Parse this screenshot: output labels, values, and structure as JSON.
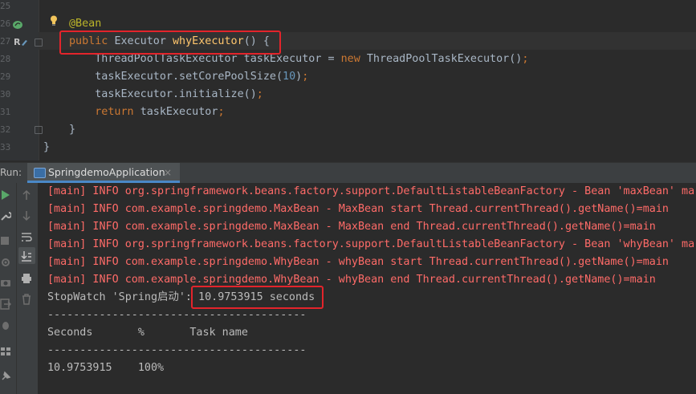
{
  "editor": {
    "line_numbers": [
      "25",
      "26",
      "27",
      "28",
      "29",
      "30",
      "31",
      "32",
      "33"
    ],
    "lines": [
      [],
      [
        {
          "t": "@Bean",
          "c": "ann"
        }
      ],
      [
        {
          "t": "public ",
          "c": "kw"
        },
        {
          "t": "Executor ",
          "c": "plain"
        },
        {
          "t": "whyExecutor",
          "c": "fn"
        },
        {
          "t": "() {",
          "c": "plain"
        }
      ],
      [
        {
          "t": "    ThreadPoolTaskExecutor taskExecutor = ",
          "c": "plain"
        },
        {
          "t": "new ",
          "c": "kw"
        },
        {
          "t": "ThreadPoolTaskExecutor()",
          "c": "plain"
        },
        {
          "t": ";",
          "c": "kw"
        }
      ],
      [
        {
          "t": "    taskExecutor.setCorePoolSize(",
          "c": "plain"
        },
        {
          "t": "10",
          "c": "num"
        },
        {
          "t": ")",
          "c": "plain"
        },
        {
          "t": ";",
          "c": "kw"
        }
      ],
      [
        {
          "t": "    taskExecutor.initialize()",
          "c": "plain"
        },
        {
          "t": ";",
          "c": "kw"
        }
      ],
      [
        {
          "t": "    ",
          "c": "plain"
        },
        {
          "t": "return ",
          "c": "kw"
        },
        {
          "t": "taskExecutor",
          "c": "plain"
        },
        {
          "t": ";",
          "c": "kw"
        }
      ],
      [
        {
          "t": "}",
          "c": "plain"
        }
      ],
      [
        {
          "t": "}",
          "c": "plain"
        }
      ]
    ]
  },
  "run_panel": {
    "label": "Run:",
    "tab_label": "SpringdemoApplication",
    "tab_close": "×"
  },
  "console": {
    "lines": [
      {
        "text": "[main] INFO org.springframework.beans.factory.support.DefaultListableBeanFactory - Bean 'maxBean' mar",
        "kind": "err"
      },
      {
        "text": "[main] INFO com.example.springdemo.MaxBean - MaxBean start Thread.currentThread().getName()=main",
        "kind": "err"
      },
      {
        "text": "[main] INFO com.example.springdemo.MaxBean - MaxBean end Thread.currentThread().getName()=main",
        "kind": "err"
      },
      {
        "text": "[main] INFO org.springframework.beans.factory.support.DefaultListableBeanFactory - Bean 'whyBean' mar",
        "kind": "err"
      },
      {
        "text": "[main] INFO com.example.springdemo.WhyBean - whyBean start Thread.currentThread().getName()=main",
        "kind": "err"
      },
      {
        "text": "[main] INFO com.example.springdemo.WhyBean - whyBean end Thread.currentThread().getName()=main",
        "kind": "err"
      },
      {
        "text": "StopWatch 'Spring启动': 10.9753915 seconds",
        "kind": "out"
      },
      {
        "text": "----------------------------------------",
        "kind": "out"
      },
      {
        "text": "Seconds       %       Task name",
        "kind": "out"
      },
      {
        "text": "----------------------------------------",
        "kind": "out"
      },
      {
        "text": "10.9753915    100%",
        "kind": "out"
      }
    ]
  },
  "colors": {
    "keyword": "#cc7832",
    "annotation": "#bbb529",
    "method": "#ffc66d",
    "number": "#6897bb",
    "log_error": "#ff6b68",
    "highlight_box": "#e3242b",
    "run_tab_underline": "#4a88c7"
  },
  "icons": {
    "gutter": [
      "bean-gutter-icon",
      "override-gutter-icon",
      "lightbulb-icon"
    ],
    "run_toolbar": [
      "rerun-icon",
      "wrench-icon",
      "stop-icon",
      "settings-icon",
      "camera-icon",
      "exit-icon",
      "debug-icon",
      "layout-icon",
      "pin-icon"
    ],
    "console_toolbar": [
      "scroll-up-icon",
      "scroll-down-icon",
      "soft-wrap-icon",
      "scroll-to-end-icon",
      "print-icon",
      "trash-icon"
    ]
  }
}
